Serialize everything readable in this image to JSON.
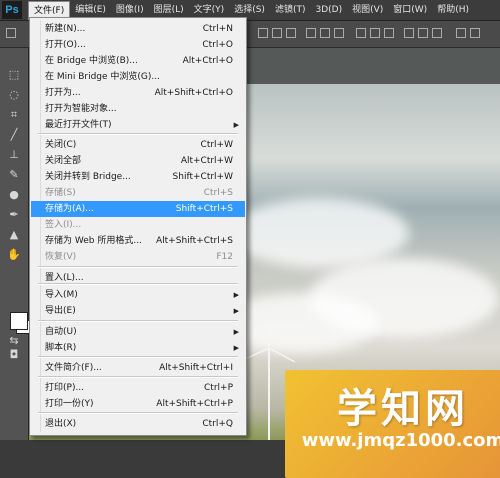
{
  "app": {
    "logo": "Ps"
  },
  "menubar": [
    {
      "label": "文件(F)",
      "active": true
    },
    {
      "label": "编辑(E)"
    },
    {
      "label": "图像(I)"
    },
    {
      "label": "图层(L)"
    },
    {
      "label": "文字(Y)"
    },
    {
      "label": "选择(S)"
    },
    {
      "label": "滤镜(T)"
    },
    {
      "label": "3D(D)"
    },
    {
      "label": "视图(V)"
    },
    {
      "label": "窗口(W)"
    },
    {
      "label": "帮助(H)"
    }
  ],
  "file_menu": {
    "items": [
      {
        "label": "新建(N)...",
        "shortcut": "Ctrl+N"
      },
      {
        "label": "打开(O)...",
        "shortcut": "Ctrl+O"
      },
      {
        "label": "在 Bridge 中浏览(B)...",
        "shortcut": "Alt+Ctrl+O"
      },
      {
        "label": "在 Mini Bridge 中浏览(G)...",
        "shortcut": ""
      },
      {
        "label": "打开为...",
        "shortcut": "Alt+Shift+Ctrl+O"
      },
      {
        "label": "打开为智能对象...",
        "shortcut": ""
      },
      {
        "label": "最近打开文件(T)",
        "shortcut": "",
        "submenu": true
      },
      {
        "label": "关闭(C)",
        "shortcut": "Ctrl+W"
      },
      {
        "label": "关闭全部",
        "shortcut": "Alt+Ctrl+W"
      },
      {
        "label": "关闭并转到 Bridge...",
        "shortcut": "Shift+Ctrl+W"
      },
      {
        "label": "存储(S)",
        "shortcut": "Ctrl+S",
        "disabled": true
      },
      {
        "label": "存储为(A)...",
        "shortcut": "Shift+Ctrl+S",
        "selected": true
      },
      {
        "label": "签入(I)...",
        "shortcut": "",
        "disabled": true
      },
      {
        "label": "存储为 Web 所用格式...",
        "shortcut": "Alt+Shift+Ctrl+S"
      },
      {
        "label": "恢复(V)",
        "shortcut": "F12",
        "disabled": true
      },
      {
        "label": "置入(L)...",
        "shortcut": ""
      },
      {
        "label": "导入(M)",
        "shortcut": "",
        "submenu": true
      },
      {
        "label": "导出(E)",
        "shortcut": "",
        "submenu": true
      },
      {
        "label": "自动(U)",
        "shortcut": "",
        "submenu": true
      },
      {
        "label": "脚本(R)",
        "shortcut": "",
        "submenu": true
      },
      {
        "label": "文件简介(F)...",
        "shortcut": "Alt+Shift+Ctrl+I"
      },
      {
        "label": "打印(P)...",
        "shortcut": "Ctrl+P"
      },
      {
        "label": "打印一份(Y)",
        "shortcut": "Alt+Shift+Ctrl+P"
      },
      {
        "label": "退出(X)",
        "shortcut": "Ctrl+Q"
      }
    ]
  },
  "tools": [
    "move-tool-icon",
    "marquee-tool-icon",
    "lasso-tool-icon",
    "crop-tool-icon",
    "eyedropper-tool-icon",
    "healing-tool-icon",
    "brush-tool-icon",
    "stamp-tool-icon",
    "history-brush-icon",
    "eraser-tool-icon",
    "blur-tool-icon",
    "dodge-tool-icon",
    "pen-tool-icon",
    "type-tool-icon",
    "path-select-icon",
    "hand-tool-icon"
  ],
  "watermark": {
    "title": "学知网",
    "url": "www.jmqz1000.com"
  },
  "colors": {
    "menubar": "#3c3c3c",
    "menu_bg": "#f0f0f0",
    "selected": "#3399ff",
    "watermark": "#f1c232"
  }
}
